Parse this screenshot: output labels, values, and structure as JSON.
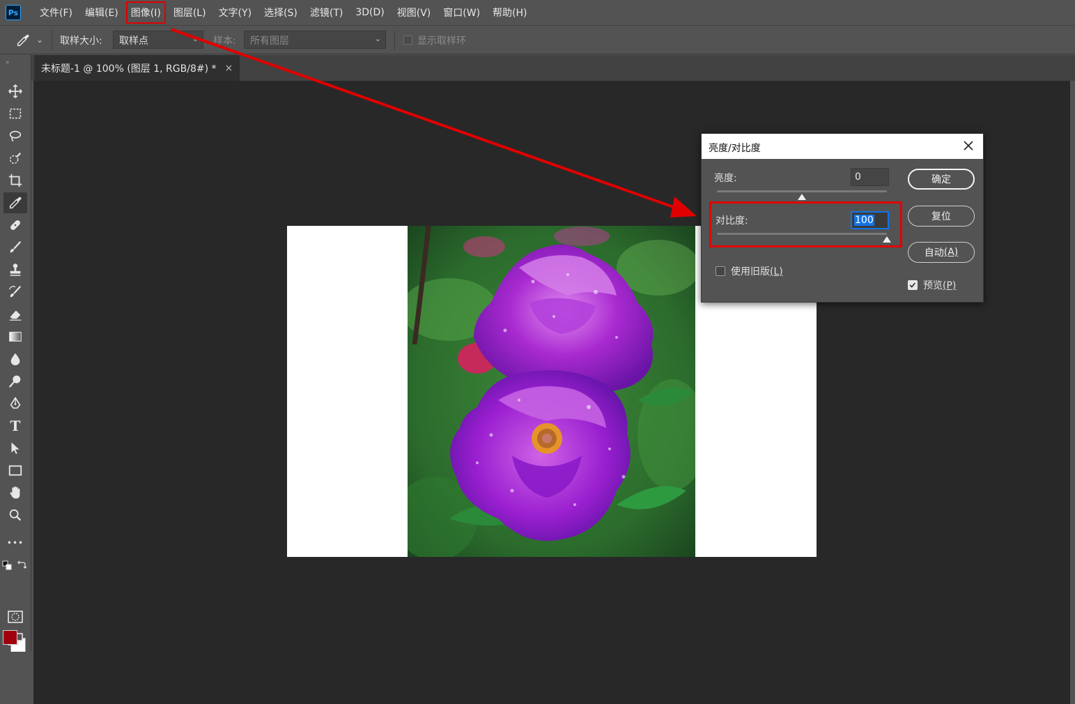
{
  "menubar": {
    "logo": "Ps",
    "items": [
      "文件(F)",
      "编辑(E)",
      "图像(I)",
      "图层(L)",
      "文字(Y)",
      "选择(S)",
      "滤镜(T)",
      "3D(D)",
      "视图(V)",
      "窗口(W)",
      "帮助(H)"
    ],
    "highlighted_item": "图像(I)"
  },
  "options_bar": {
    "sample_size_label": "取样大小:",
    "sample_size_value": "取样点",
    "sample_label": "样本:",
    "sample_value": "所有图层",
    "show_ring_label": "显示取样环"
  },
  "document_tab": {
    "title": "未标题-1 @ 100% (图层 1, RGB/8#) *",
    "close": "×"
  },
  "toolbar": {
    "tools": [
      "move-icon",
      "marquee-icon",
      "lasso-icon",
      "quick-select-icon",
      "crop-icon",
      "eyedropper-icon",
      "healing-icon",
      "brush-icon",
      "stamp-icon",
      "history-brush-icon",
      "eraser-icon",
      "gradient-icon",
      "blur-icon",
      "dodge-icon",
      "pen-icon",
      "text-icon",
      "path-select-icon",
      "rectangle-icon",
      "hand-icon",
      "zoom-icon",
      "more-icon"
    ],
    "active_tool": "eyedropper-icon",
    "text_tool_glyph": "T",
    "more_glyph": "•••",
    "foreground_color": "#a0000e",
    "background_color": "#ffffff"
  },
  "dialog": {
    "title": "亮度/对比度",
    "brightness_label": "亮度:",
    "brightness_value": "0",
    "brightness_level": 0.5,
    "contrast_label": "对比度:",
    "contrast_value": "100",
    "contrast_level": 1.0,
    "legacy_label": "使用旧版",
    "legacy_key": "(L)",
    "legacy_checked": false,
    "ok_label": "确定",
    "reset_label": "复位",
    "auto_label": "自动",
    "auto_key": "(A)",
    "preview_label": "预览",
    "preview_key": "(P)",
    "preview_checked": true
  },
  "annotation": {
    "color": "#e10000"
  }
}
